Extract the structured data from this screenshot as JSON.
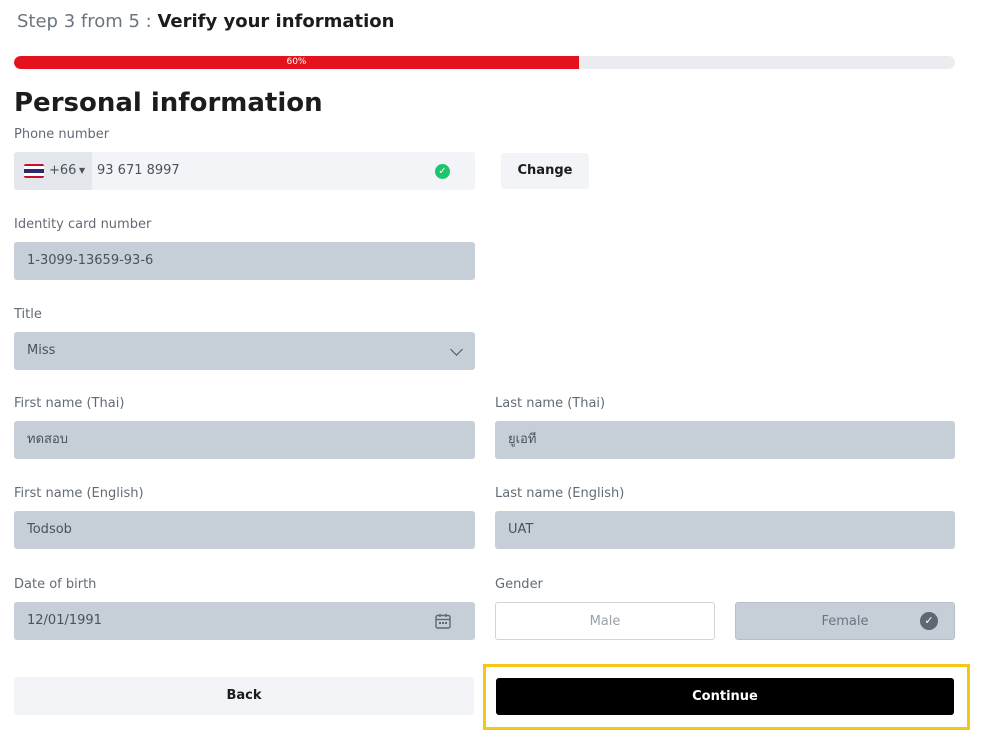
{
  "header": {
    "step_text": "Step 3 from 5 :",
    "step_title": "Verify your information"
  },
  "progress": {
    "value": 0.6,
    "label": "60%"
  },
  "section_title": "Personal information",
  "phone": {
    "label": "Phone number",
    "country_code": "+66",
    "number": "93 671 8997",
    "verified": true,
    "change_label": "Change"
  },
  "identity": {
    "label": "Identity card number",
    "value": "1-3099-13659-93-6"
  },
  "title_field": {
    "label": "Title",
    "value": "Miss"
  },
  "first_name_thai": {
    "label": "First name (Thai)",
    "value": "ทดสอบ"
  },
  "last_name_thai": {
    "label": "Last name (Thai)",
    "value": "ยูเอที"
  },
  "first_name_en": {
    "label": "First name (English)",
    "value": "Todsob"
  },
  "last_name_en": {
    "label": "Last name (English)",
    "value": "UAT"
  },
  "dob": {
    "label": "Date of birth",
    "value": "12/01/1991"
  },
  "gender": {
    "label": "Gender",
    "options": [
      "Male",
      "Female"
    ],
    "selected": "Female"
  },
  "actions": {
    "back_label": "Back",
    "continue_label": "Continue"
  },
  "colors": {
    "accent": "#e3121d",
    "verified": "#1fc56d",
    "primary_button": "#000000",
    "highlight": "#f5c518"
  },
  "icons": {
    "flag": "thailand-flag-icon",
    "verified": "check-circle-icon",
    "dropdown": "chevron-down-icon",
    "calendar": "calendar-icon",
    "selected": "check-circle-icon"
  }
}
